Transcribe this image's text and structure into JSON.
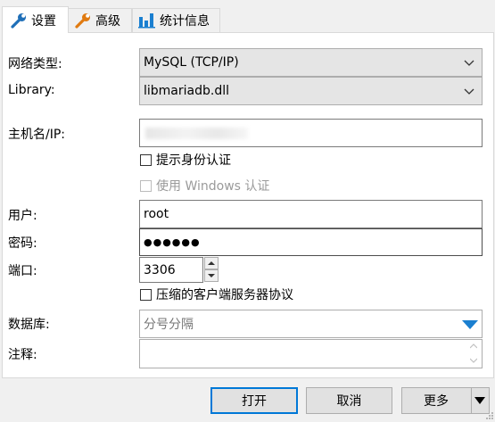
{
  "tabs": [
    {
      "label": "设置",
      "icon": "wrench-icon"
    },
    {
      "label": "高级",
      "icon": "wrench-orange-icon"
    },
    {
      "label": "统计信息",
      "icon": "bar-chart-icon"
    }
  ],
  "form": {
    "network_type_label": "网络类型:",
    "network_type_value": "MySQL (TCP/IP)",
    "library_label": "Library:",
    "library_value": "libmariadb.dll",
    "host_label": "主机名/IP:",
    "host_value": "",
    "prompt_auth_label": "提示身份认证",
    "windows_auth_label": "使用 Windows 认证",
    "user_label": "用户:",
    "user_value": "root",
    "password_label": "密码:",
    "password_value": "●●●●●●",
    "port_label": "端口:",
    "port_value": "3306",
    "compress_label": "压缩的客户端服务器协议",
    "database_label": "数据库:",
    "database_placeholder": "分号分隔",
    "comment_label": "注释:",
    "comment_value": ""
  },
  "buttons": {
    "open": "打开",
    "cancel": "取消",
    "more": "更多"
  },
  "colors": {
    "accent": "#0078d7",
    "tab_icon_blue": "#1a7fd0",
    "tab_icon_orange": "#e07a10"
  }
}
